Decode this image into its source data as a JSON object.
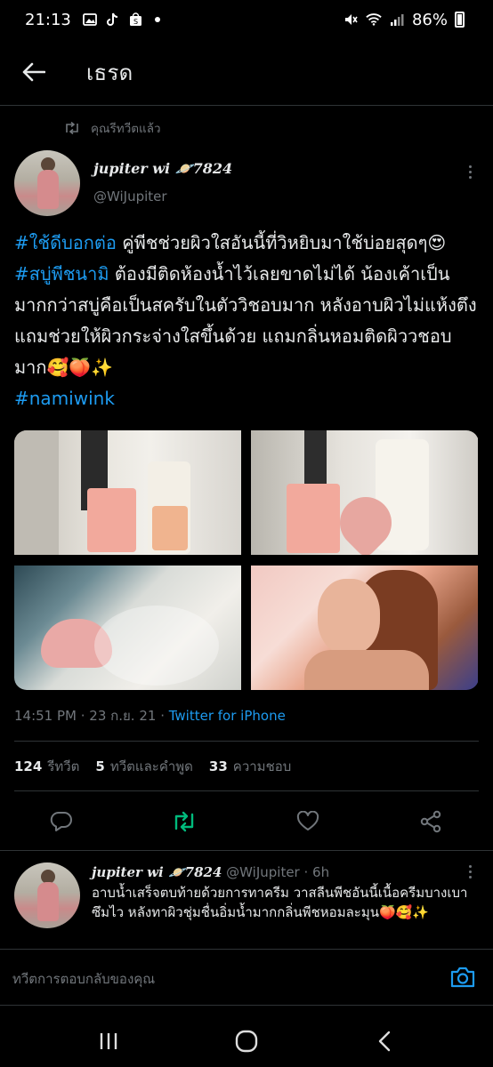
{
  "status_bar": {
    "time": "21:13",
    "battery": "86%",
    "left_icons": [
      "gallery-icon",
      "tiktok-icon",
      "shopee-icon"
    ],
    "right_icons": [
      "mute-icon",
      "wifi-icon",
      "signal-icon",
      "battery-icon"
    ]
  },
  "header": {
    "title": "เธรด"
  },
  "retweet": {
    "label": "คุณรีทวีตแล้ว"
  },
  "tweet": {
    "author_name": "jupiter wi 🪐7824",
    "author_handle": "@WiJupiter",
    "text_segments": [
      {
        "text": "#ใช้ดีบอกต่อ",
        "hashtag": true
      },
      {
        "text": " คู่พีชช่วยผิวใสอันนี้ที่วิหยิบมาใช้บ่อยสุดๆ😍",
        "hashtag": false
      },
      {
        "text": "#สบู่พีชนามิ",
        "hashtag": true
      },
      {
        "text": " ต้องมีติดห้องน้ำไว้เลยขาดไม่ได้ น้องเค้าเป็นมากกว่าสบู่คือเป็นสครับในตัววิชอบมาก หลังอาบผิวไม่แห้งตึง แถมช่วยให้ผิวกระจ่างใสขึ้นด้วย แถมกลิ่นหอมติดผิววชอบมาก🥰🍑✨",
        "hashtag": false
      },
      {
        "text": "#namiwink",
        "hashtag": true
      }
    ],
    "time": "14:51 PM",
    "date": "23 ก.ย. 21",
    "source": "Twitter for iPhone",
    "stats": {
      "retweets": {
        "count": "124",
        "label": "รีทวีต"
      },
      "quotes": {
        "count": "5",
        "label": "ทวีตและคำพูด"
      },
      "likes": {
        "count": "33",
        "label": "ความชอบ"
      }
    }
  },
  "reply": {
    "author_name": "jupiter wi 🪐7824",
    "author_handle": "@WiJupiter",
    "time_ago": "6h",
    "text": "อาบน้ำเสร็จตบท้ายด้วยการทาครีม วาสลีนพีชอันนี้เนื้อครีมบางเบาซึมไว หลังทาผิวชุ่มชื่นอิ่มน้ำมากกลิ่นพีชหอมละมุน🍑🥰✨"
  },
  "compose": {
    "placeholder": "ทวีตการตอบกลับของคุณ"
  },
  "colors": {
    "background": "#000000",
    "accent": "#1d9bf0",
    "retweet_active": "#00ba7c",
    "muted": "#71767b",
    "text": "#e7e9ea",
    "divider": "#2f3336"
  }
}
